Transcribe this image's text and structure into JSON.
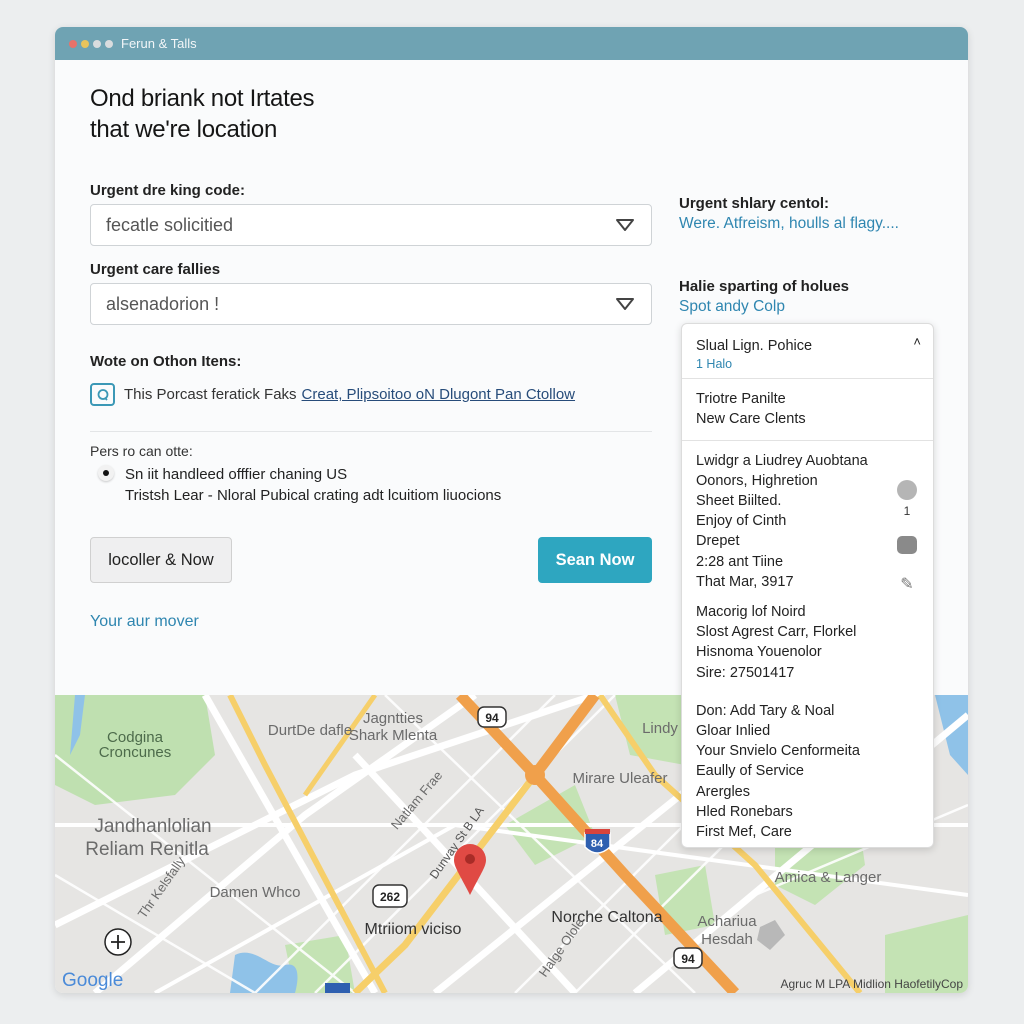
{
  "window": {
    "title": "Ferun & Talls",
    "dots": [
      "#e8726a",
      "#e9c45c",
      "#d9dcde",
      "#d9dcde"
    ]
  },
  "header": {
    "line1": "Ond briank not Irtates",
    "line2": "that we're location"
  },
  "form": {
    "field1": {
      "label": "Urgent dre king code:",
      "value": "fecatle solicitied"
    },
    "field2": {
      "label": "Urgent care fallies",
      "value": "alsenadorion !"
    },
    "notes_label": "Wote on Othon Itens:",
    "note_text": "This Porcast feratick Faks",
    "note_link": "Creat, Plipsoitoo oN Dlugont Pan Ctollow",
    "radio_label": "Pers ro can otte:",
    "radio_line1": "Sn iit handleed offfier chaning US",
    "radio_line2": "Tristsh Lear - Nloral Pubical crating adt lcuitiom liuocions",
    "secondary_button": "locoller & Now",
    "primary_button": "Sean Now",
    "footer_link": "Your aur mover"
  },
  "right": {
    "section1": {
      "label": "Urgent shlary centol:",
      "link": "Were. Atfreism, houlls al flagy...."
    },
    "section2": {
      "label": "Halie sparting of holues",
      "link": "Spot andy Colp"
    }
  },
  "popup": {
    "title": "Slual Lign. Pohice",
    "subtitle": "1 Halo",
    "group1": [
      "Triotre Panilte",
      "New Care Clents"
    ],
    "group2": [
      "Lwidgr a Liudrey Auobtana",
      "Oonors, Highretion",
      "Sheet Biilted.",
      "Enjoy of Cinth",
      "Drepet",
      "2:28 ant Tiine",
      "That Mar, 3917"
    ],
    "group3": [
      "Macorig lof Noird",
      "Slost Agrest Carr, Florkel",
      "Hisnoma Youenolor",
      "Sire: 27501417"
    ],
    "group4": [
      "Don: Add Tary & Noal",
      "Gloar Inlied",
      "Your Snvielo Cenformeita",
      "Eaully of Service",
      "Arergles",
      "Hled Ronebars",
      "First Mef, Care"
    ],
    "badge_count": "1"
  },
  "map": {
    "labels": {
      "codgina1": "Codgina",
      "codgina2": "Croncunes",
      "durt": "DurtDe dafle",
      "jag1": "Jagntties",
      "jag2": "Shark Mlenta",
      "lindy": "Lindy",
      "mirare": "Mirare Uleafer",
      "jand1": "Jandhanlolian",
      "jand2": "Reliam Renitla",
      "damen": "Damen Whco",
      "mtriiom": "Mtriiom viciso",
      "norche": "Norche Caltona",
      "amica": "Amica & Langer",
      "ach1": "Achariua",
      "ach2": "Hesdah",
      "natlam": "Natlam Frae",
      "dur": "Dunvay St B LA",
      "halge": "Halge Olole",
      "thr": "Thr Kelsfally"
    },
    "shields": {
      "s94a": "94",
      "s262": "262",
      "i84": "84",
      "s94b": "94"
    },
    "logo": "Google",
    "attribution": "Agruc M LPA Midlion HaofetilyCop",
    "colors": {
      "highway": "#f0a04b",
      "arterial": "#f6cf6a",
      "park": "#bfe0b0",
      "water": "#8fc2e8",
      "pin": "#e04a44"
    }
  }
}
